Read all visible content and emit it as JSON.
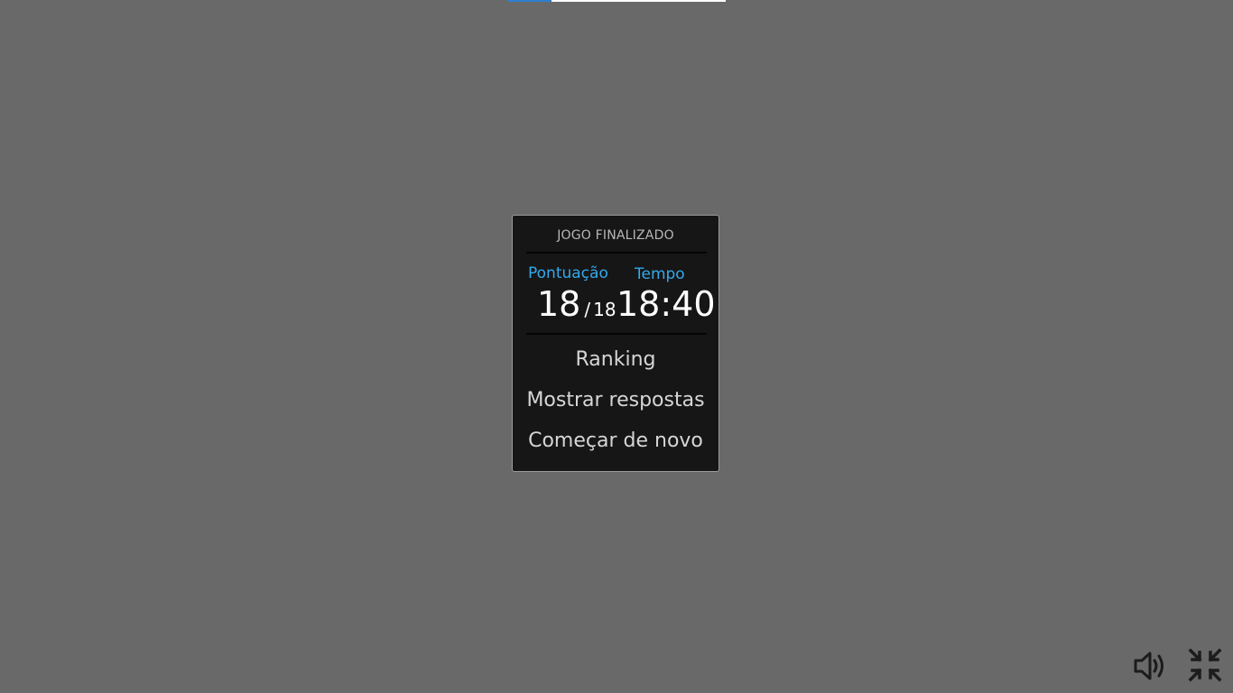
{
  "progress": {
    "fraction": 0.2
  },
  "dialog": {
    "title": "JOGO FINALIZADO",
    "score_label": "Pontuação",
    "time_label": "Tempo",
    "score": "18",
    "score_separator": "/",
    "score_total": "18",
    "time": "18:40",
    "buttons": [
      "Ranking",
      "Mostrar respostas",
      "Começar de novo"
    ]
  },
  "controls": {
    "sound_icon": "speaker-icon",
    "fullscreen_icon": "exit-fullscreen-icon"
  },
  "colors": {
    "background": "#696969",
    "dialog_bg": "#161616",
    "accent": "#33a9ec",
    "progress": "#2f7fd0"
  }
}
